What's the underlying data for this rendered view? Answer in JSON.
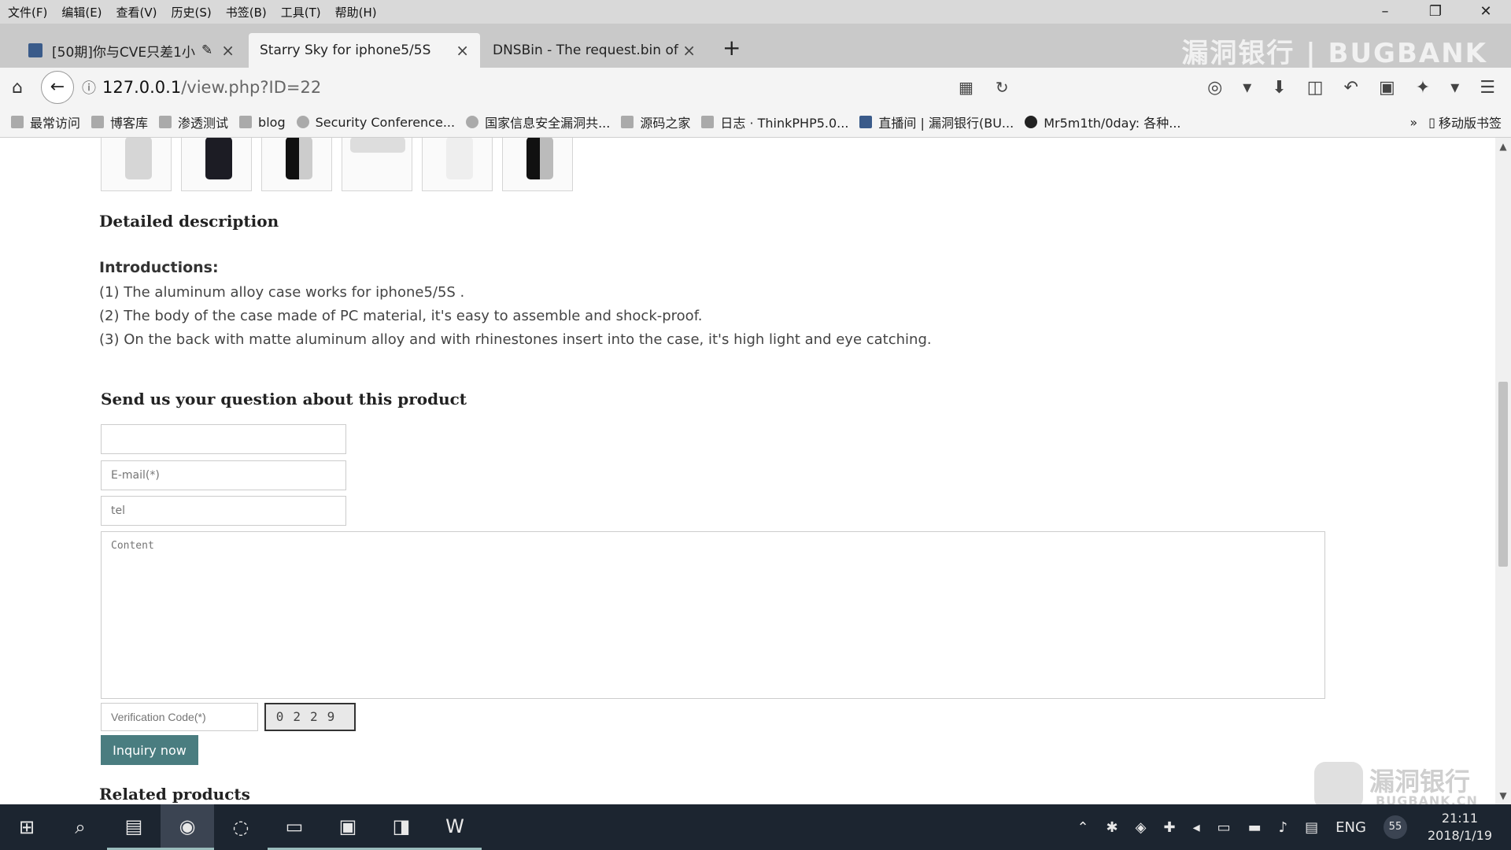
{
  "menubar": {
    "items": [
      "文件(F)",
      "编辑(E)",
      "查看(V)",
      "历史(S)",
      "书签(B)",
      "工具(T)",
      "帮助(H)"
    ]
  },
  "window_controls": {
    "minimize": "–",
    "restore": "❐",
    "close": "✕"
  },
  "tabs": [
    {
      "label": "[50期]你与CVE只差1小",
      "active": false,
      "icon": "page-icon",
      "pinned_icon": "brush-icon"
    },
    {
      "label": "Starry Sky for iphone5/5S",
      "active": true
    },
    {
      "label": "DNSBin - The request.bin of I",
      "active": false
    }
  ],
  "new_tab_label": "+",
  "watermark_top": "漏洞银行 | BUGBANK",
  "urlbar": {
    "host": "127.0.0.1",
    "path": "/view.php?ID=22"
  },
  "bookmarks": [
    "最常访问",
    "博客库",
    "渗透测试",
    "blog",
    "Security Conference...",
    "国家信息安全漏洞共...",
    "源码之家",
    "日志 · ThinkPHP5.0...",
    "直播间 | 漏洞银行(BU...",
    "Mr5m1th/0day: 各种..."
  ],
  "bookmarks_more": "»",
  "bookmarks_mobile": "移动版书签",
  "page": {
    "detailed_description": "Detailed description",
    "intro_title": "Introductions:",
    "intro_lines": [
      "(1) The aluminum alloy case works for iphone5/5S .",
      "(2) The body of the case made of PC material, it's easy to assemble and shock-proof.",
      "(3) On the back with matte aluminum alloy and with rhinestones insert into the case, it's high light and eye catching."
    ],
    "send_title": "Send us your question about this product",
    "form": {
      "name_placeholder": "",
      "email_placeholder": "E-mail(*)",
      "tel_placeholder": "tel",
      "content_placeholder": "Content",
      "verification_placeholder": "Verification Code(*)",
      "captcha_text": "0229",
      "submit_label": "Inquiry now"
    },
    "related_title": "Related products"
  },
  "watermark_bottom": {
    "title": "漏洞银行",
    "subtitle": "BUGBANK.CN"
  },
  "taskbar": {
    "tray_lang": "ENG",
    "notif_count": "55",
    "time": "21:11",
    "date": "2018/1/19"
  }
}
